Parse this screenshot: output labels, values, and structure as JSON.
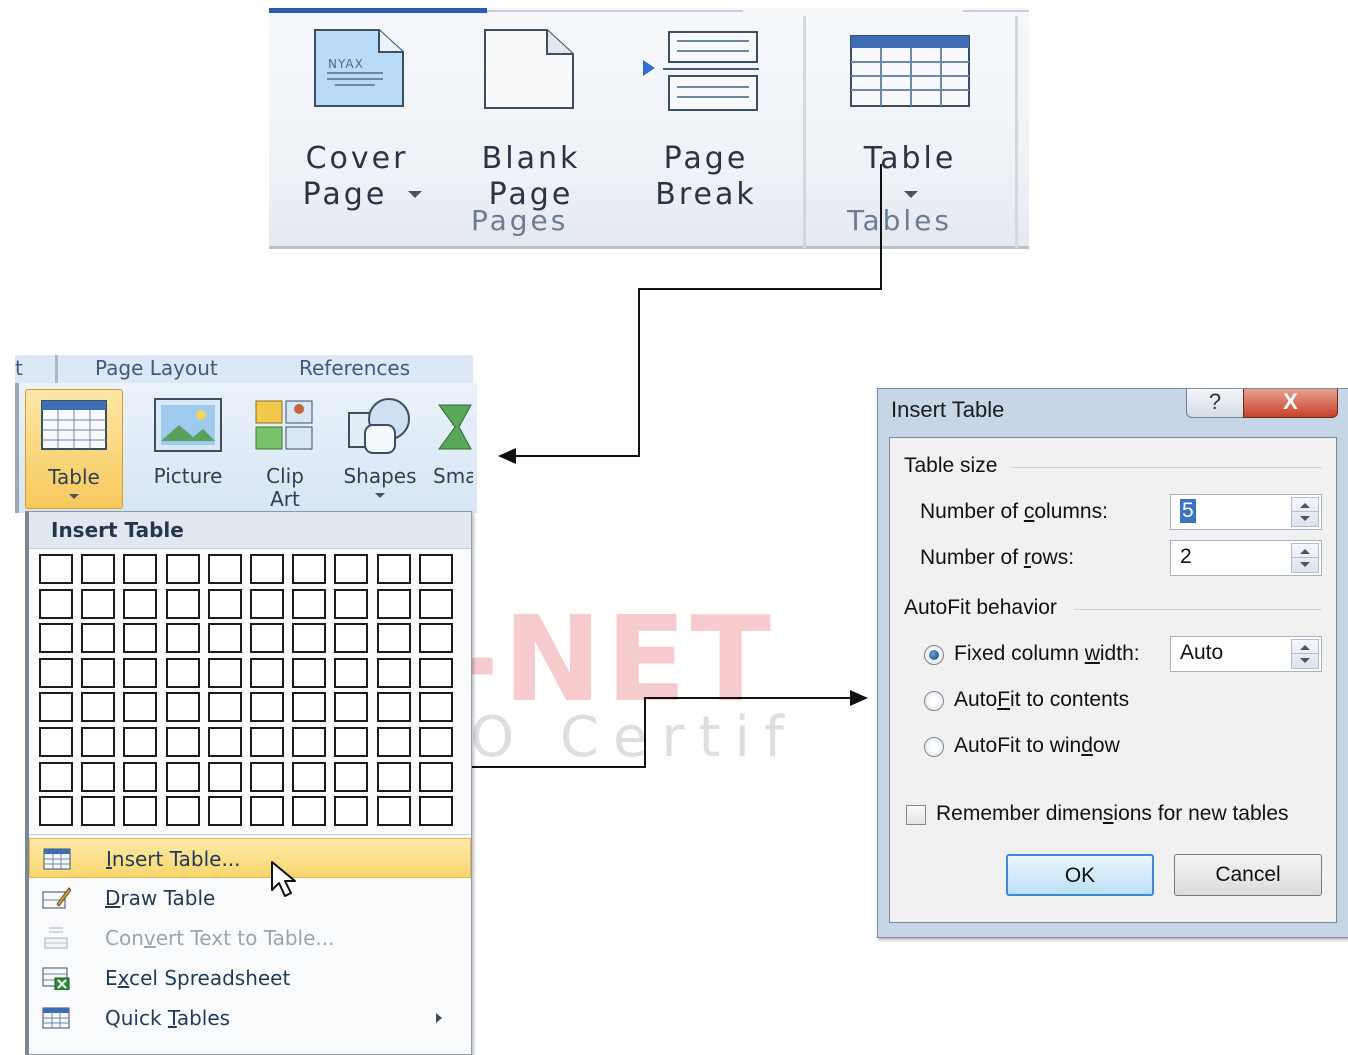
{
  "ribbon": {
    "buttons": [
      {
        "line1": "Cover",
        "line2": "Page"
      },
      {
        "line1": "Blank",
        "line2": "Page"
      },
      {
        "line1": "Page",
        "line2": "Break"
      },
      {
        "line1": "Table",
        "line2": ""
      }
    ],
    "groups": [
      "Pages",
      "Tables"
    ],
    "cover_icon_text": "NYAX"
  },
  "insert_ribbon": {
    "tabs": [
      "t",
      "Page Layout",
      "References"
    ],
    "buttons": [
      {
        "label": "Table",
        "label2": ""
      },
      {
        "label": "Picture",
        "label2": ""
      },
      {
        "label": "Clip",
        "label2": "Art"
      },
      {
        "label": "Shapes",
        "label2": ""
      },
      {
        "label": "Sma",
        "label2": ""
      }
    ]
  },
  "dropdown": {
    "header": "Insert Table",
    "grid": {
      "columns": 10,
      "rows": 8
    },
    "items": [
      {
        "pre": "",
        "u": "I",
        "post": "nsert Table...",
        "icon": "insert-table-icon",
        "enabled": true
      },
      {
        "pre": "",
        "u": "D",
        "post": "raw Table",
        "icon": "draw-table-icon",
        "enabled": true
      },
      {
        "pre": "Con",
        "u": "v",
        "post": "ert Text to Table...",
        "icon": "convert-text-icon",
        "enabled": false
      },
      {
        "pre": "E",
        "u": "x",
        "post": "cel Spreadsheet",
        "icon": "excel-spreadsheet-icon",
        "enabled": true
      },
      {
        "pre": "Quick ",
        "u": "T",
        "post": "ables",
        "icon": "quick-tables-icon",
        "enabled": true
      }
    ]
  },
  "dialog": {
    "title": "Insert Table",
    "help_glyph": "?",
    "close_glyph": "X",
    "table_size_label": "Table size",
    "columns_label_pre": "Number of ",
    "columns_label_u": "c",
    "columns_label_post": "olumns:",
    "columns_value": "5",
    "rows_label_pre": "Number of ",
    "rows_label_u": "r",
    "rows_label_post": "ows:",
    "rows_value": "2",
    "autofit_label": "AutoFit behavior",
    "fixed_pre": "Fixed column ",
    "fixed_u": "w",
    "fixed_post": "idth:",
    "fixed_value": "Auto",
    "contents_pre": "Auto",
    "contents_u": "F",
    "contents_post": "it to contents",
    "window_pre": "AutoFit to win",
    "window_u": "d",
    "window_post": "ow",
    "remember_pre": "Remember dimen",
    "remember_u": "s",
    "remember_post": "ions for new tables",
    "selected_option": "fixed",
    "remember_checked": false,
    "ok_label": "OK",
    "cancel_label": "Cancel"
  },
  "watermark": {
    "main": "-NET",
    "sub": "O Certif"
  },
  "colors": {
    "highlight": "#f9d66c",
    "ribbon_tab_active": "#2a5bb0",
    "close_button": "#c8412a",
    "default_button": "#3b8ad8"
  }
}
